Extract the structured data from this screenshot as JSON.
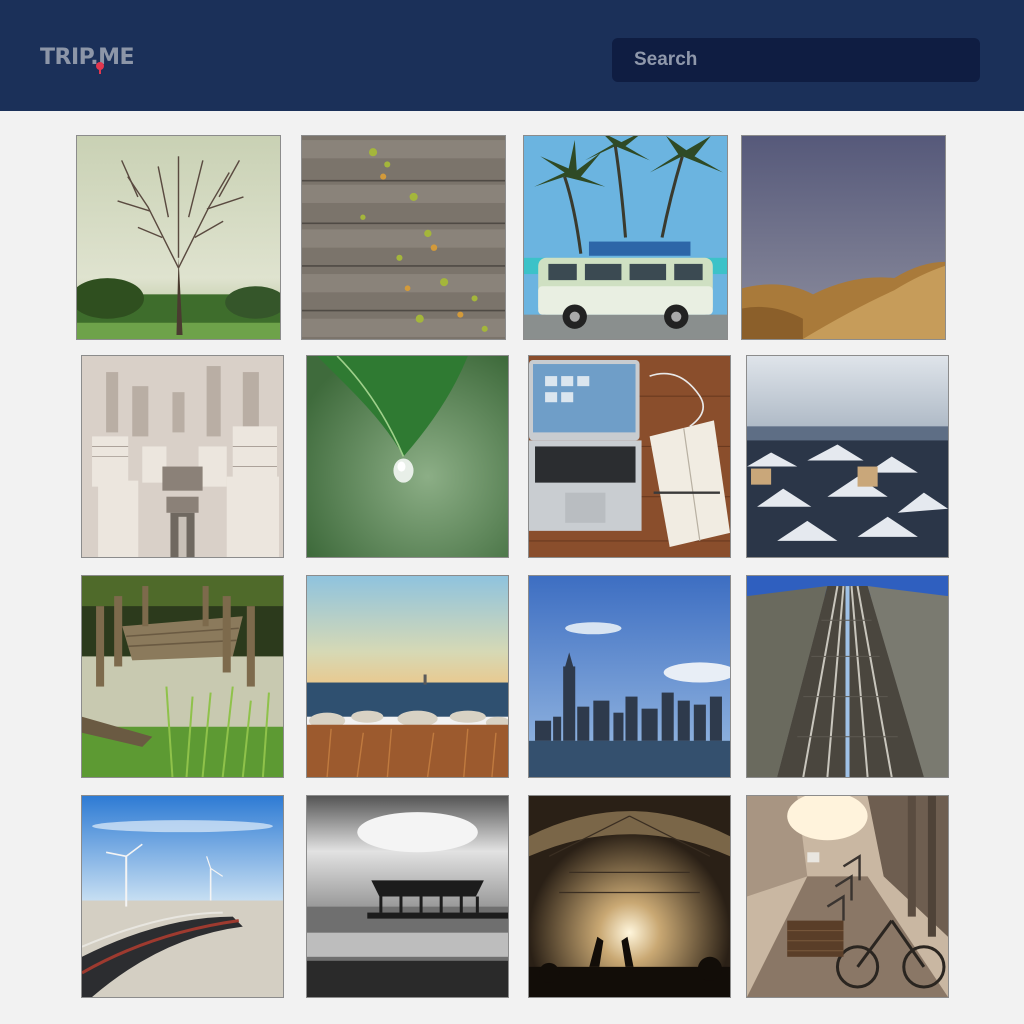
{
  "app": {
    "logo_text": "TRIP.ME"
  },
  "search": {
    "placeholder": "Search",
    "value": ""
  },
  "colors": {
    "header_bg": "#1b3059",
    "search_bg": "#0f1d42",
    "logo_text": "#8d96a8",
    "logo_pin": "#e2374f",
    "page_bg": "#f2f2f2"
  },
  "gallery": {
    "photos": [
      {
        "subject": "bare-tree"
      },
      {
        "subject": "wooden-planks"
      },
      {
        "subject": "camper-van-palms"
      },
      {
        "subject": "desert-dunes"
      },
      {
        "subject": "city-aerial-sepia"
      },
      {
        "subject": "leaf-water-drop"
      },
      {
        "subject": "laptop-notebook-desk"
      },
      {
        "subject": "snowy-rooftops"
      },
      {
        "subject": "old-pier-grass"
      },
      {
        "subject": "rocky-shore-sunset"
      },
      {
        "subject": "city-skyline"
      },
      {
        "subject": "railway-tracks"
      },
      {
        "subject": "road-wind-turbines"
      },
      {
        "subject": "pier-pavilion-bw"
      },
      {
        "subject": "concert-crowd"
      },
      {
        "subject": "street-bicycles"
      }
    ]
  }
}
